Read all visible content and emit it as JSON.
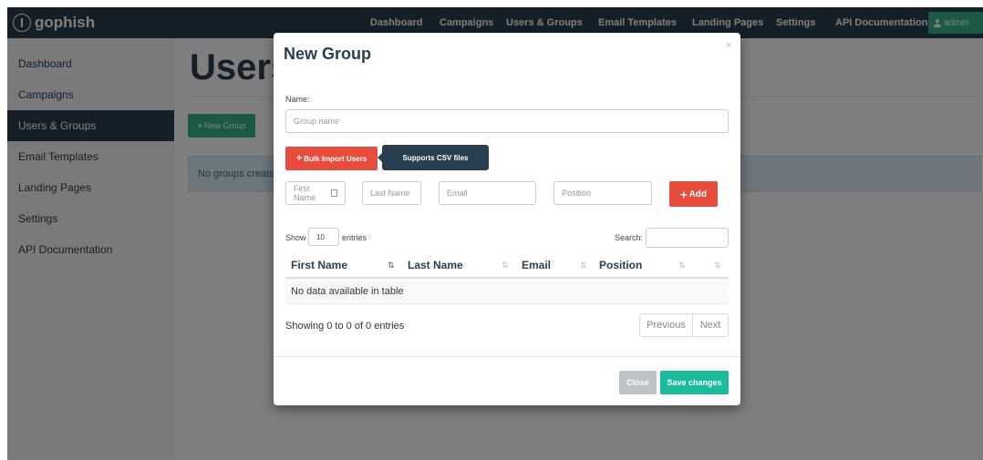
{
  "navbar": {
    "brand": "gophish",
    "links": [
      "Dashboard",
      "Campaigns",
      "Users & Groups",
      "Email Templates",
      "Landing Pages",
      "Settings",
      "API Documentation"
    ],
    "user": "admin",
    "colors": {
      "bg": "#283f50",
      "admin_button": "#37b38a"
    }
  },
  "sidebar": {
    "items": [
      {
        "label": "Dashboard",
        "active": false
      },
      {
        "label": "Campaigns",
        "active": false
      },
      {
        "label": "Users & Groups",
        "active": true
      },
      {
        "label": "Email Templates",
        "active": false
      },
      {
        "label": "Landing Pages",
        "active": false
      },
      {
        "label": "Settings",
        "active": false
      },
      {
        "label": "API Documentation",
        "active": false
      }
    ]
  },
  "main": {
    "title": "Users & Groups",
    "new_group_label": "New Group",
    "empty_message": "No groups created yet. Let's create one!"
  },
  "modal": {
    "title": "New Group",
    "close_symbol": "×",
    "name_label": "Name:",
    "name_placeholder": "Group name",
    "bulk_import_label": "Bulk Import Users",
    "tooltip": "Supports CSV files",
    "first_name_placeholder": "First Name",
    "last_name_placeholder": "Last Name",
    "email_placeholder": "Email",
    "position_placeholder": "Position",
    "add_label": "Add",
    "table": {
      "show_label": "Show",
      "entries_value": "10",
      "entries_label": "entries",
      "search_label": "Search:",
      "columns": [
        "First Name",
        "Last Name",
        "Email",
        "Position"
      ],
      "empty_text": "No data available in table",
      "info_text": "Showing 0 to 0 of 0 entries",
      "previous_label": "Previous",
      "next_label": "Next"
    },
    "close_label": "Close",
    "save_label": "Save changes",
    "colors": {
      "danger": "#e74c3c",
      "primary": "#1abc9c",
      "default": "#bdc3c7"
    }
  }
}
